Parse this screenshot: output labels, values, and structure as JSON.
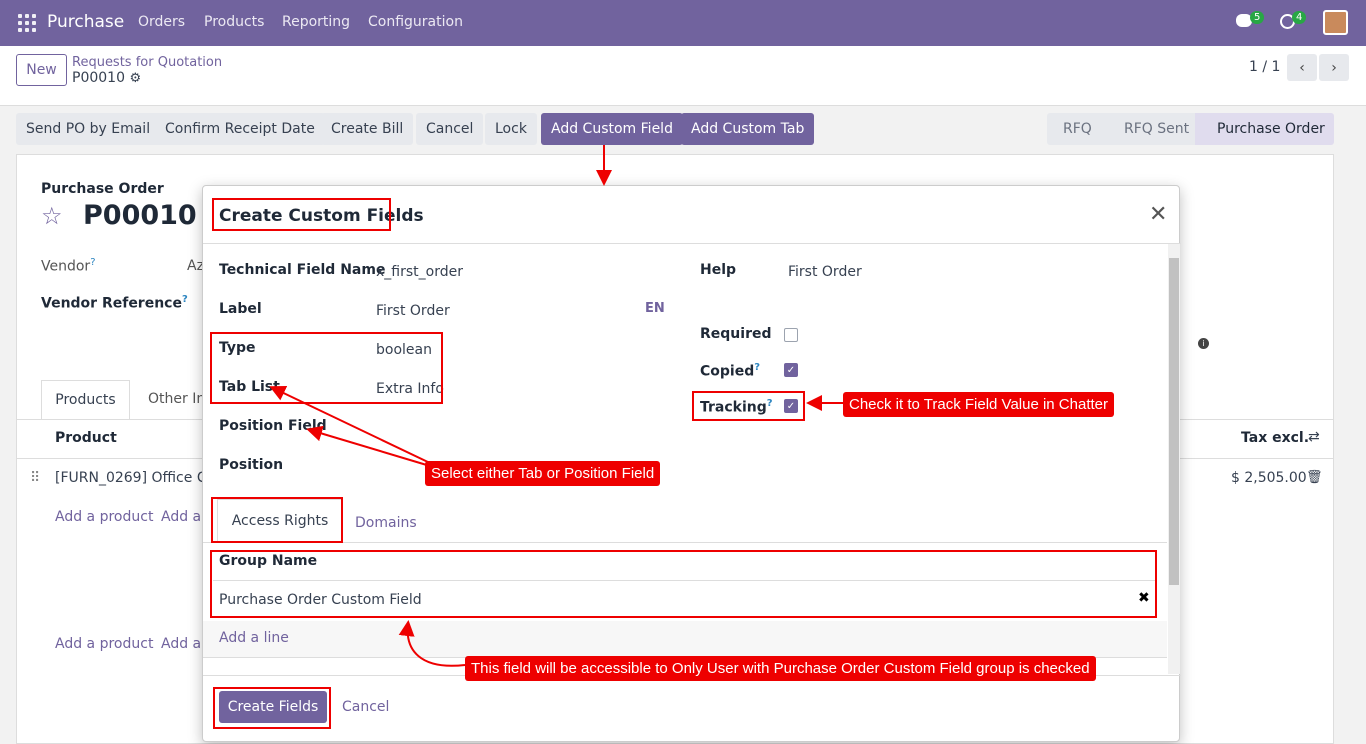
{
  "nav": {
    "brand": "Purchase",
    "menu": [
      "Orders",
      "Products",
      "Reporting",
      "Configuration"
    ],
    "chat_count": "5",
    "activity_count": "4"
  },
  "control": {
    "new_label": "New",
    "breadcrumb_parent": "Requests for Quotation",
    "breadcrumb_current": "P00010",
    "pager": "1 / 1"
  },
  "actions": [
    "Send PO by Email",
    "Confirm Receipt Date",
    "Create Bill",
    "Cancel",
    "Lock",
    "Add Custom Field",
    "Add Custom Tab"
  ],
  "status_steps": [
    "RFQ",
    "RFQ Sent",
    "Purchase Order"
  ],
  "sheet": {
    "doc_label": "Purchase Order",
    "doc_number": "P00010",
    "vendor_label": "Vendor",
    "vendor_value": "Az",
    "vendor_ref_label": "Vendor Reference",
    "tab_products": "Products",
    "tab_other": "Other In",
    "col_product": "Product",
    "col_tax": "Tax excl.",
    "row_product": "[FURN_0269] Office Ch",
    "row_amount": "$ 2,505.00",
    "add_product": "Add a product",
    "add_section": "Add a s"
  },
  "modal": {
    "title": "Create Custom Fields",
    "fields": {
      "tech_name_label": "Technical Field Name",
      "tech_name_value": "x_first_order",
      "label_label": "Label",
      "label_value": "First Order",
      "lang": "EN",
      "type_label": "Type",
      "type_value": "boolean",
      "tab_list_label": "Tab List",
      "tab_list_value": "Extra Info",
      "position_field_label": "Position Field",
      "position_label": "Position",
      "help_label": "Help",
      "help_value": "First Order",
      "required_label": "Required",
      "copied_label": "Copied",
      "tracking_label": "Tracking"
    },
    "tabs": {
      "access": "Access Rights",
      "domains": "Domains"
    },
    "group_header": "Group Name",
    "group_row": "Purchase Order Custom Field",
    "add_line": "Add a line",
    "create_btn": "Create Fields",
    "cancel_btn": "Cancel"
  },
  "callouts": {
    "tracking": "Check it to Track Field Value in Chatter",
    "tab_position": "Select either Tab or Position Field",
    "group": "This field will be accessible to Only User with Purchase Order Custom Field group is checked"
  },
  "colors": {
    "brand": "#71639e",
    "annotation": "#ee0000"
  }
}
